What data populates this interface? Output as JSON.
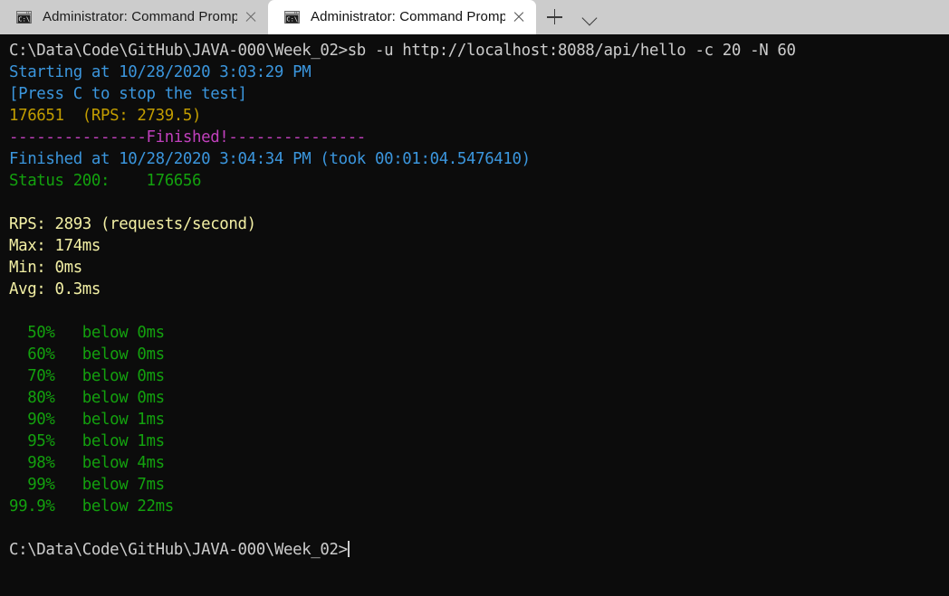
{
  "window": {
    "titlebar_bg": "#cccccc",
    "tabs": [
      {
        "icon": "cmd-icon",
        "title": "Administrator: Command Promp",
        "active": false
      },
      {
        "icon": "cmd-icon",
        "title": "Administrator: Command Promp",
        "active": true
      }
    ],
    "new_tab_label": "+",
    "tab_menu_label": "⌄"
  },
  "terminal": {
    "background": "#0c0c0c",
    "colors": {
      "default": "#cccccc",
      "blue": "#3b96dd",
      "yellow_dark": "#c19c00",
      "yellow_light": "#f2efa4",
      "magenta": "#c040bc",
      "green": "#13a10e"
    },
    "lines": [
      {
        "text": "C:\\Data\\Code\\GitHub\\JAVA-000\\Week_02>sb -u http://localhost:8088/api/hello -c 20 -N 60",
        "color": "default"
      },
      {
        "text": "Starting at 10/28/2020 3:03:29 PM",
        "color": "blue"
      },
      {
        "text": "[Press C to stop the test]",
        "color": "blue"
      },
      {
        "text": "176651  (RPS: 2739.5)",
        "color": "yellow_dark"
      },
      {
        "text": "---------------Finished!---------------",
        "color": "magenta"
      },
      {
        "text": "Finished at 10/28/2020 3:04:34 PM (took 00:01:04.5476410)",
        "color": "blue"
      },
      {
        "text": "Status 200:    176656",
        "color": "green"
      },
      {
        "text": "",
        "color": "default"
      },
      {
        "text": "RPS: 2893 (requests/second)",
        "color": "yellow_light"
      },
      {
        "text": "Max: 174ms",
        "color": "yellow_light"
      },
      {
        "text": "Min: 0ms",
        "color": "yellow_light"
      },
      {
        "text": "Avg: 0.3ms",
        "color": "yellow_light"
      },
      {
        "text": "",
        "color": "default"
      },
      {
        "text": "  50%   below 0ms",
        "color": "green"
      },
      {
        "text": "  60%   below 0ms",
        "color": "green"
      },
      {
        "text": "  70%   below 0ms",
        "color": "green"
      },
      {
        "text": "  80%   below 0ms",
        "color": "green"
      },
      {
        "text": "  90%   below 1ms",
        "color": "green"
      },
      {
        "text": "  95%   below 1ms",
        "color": "green"
      },
      {
        "text": "  98%   below 4ms",
        "color": "green"
      },
      {
        "text": "  99%   below 7ms",
        "color": "green"
      },
      {
        "text": "99.9%   below 22ms",
        "color": "green"
      },
      {
        "text": "",
        "color": "default"
      }
    ],
    "prompt": "C:\\Data\\Code\\GitHub\\JAVA-000\\Week_02>",
    "prompt_color": "default"
  },
  "benchmark": {
    "command": "sb -u http://localhost:8088/api/hello -c 20 -N 60",
    "url": "http://localhost:8088/api/hello",
    "concurrency": "20",
    "duration_seconds": "60",
    "started_at": "10/28/2020 3:03:29 PM",
    "finished_at": "10/28/2020 3:04:34 PM",
    "elapsed": "00:01:04.5476410",
    "live_requests": "176651",
    "live_rps": "2739.5",
    "status_200_count": "176656",
    "rps": "2893",
    "max_ms": "174ms",
    "min_ms": "0ms",
    "avg_ms": "0.3ms",
    "percentiles": [
      {
        "p": "50%",
        "value": "below 0ms"
      },
      {
        "p": "60%",
        "value": "below 0ms"
      },
      {
        "p": "70%",
        "value": "below 0ms"
      },
      {
        "p": "80%",
        "value": "below 0ms"
      },
      {
        "p": "90%",
        "value": "below 1ms"
      },
      {
        "p": "95%",
        "value": "below 1ms"
      },
      {
        "p": "98%",
        "value": "below 4ms"
      },
      {
        "p": "99%",
        "value": "below 7ms"
      },
      {
        "p": "99.9%",
        "value": "below 22ms"
      }
    ]
  }
}
